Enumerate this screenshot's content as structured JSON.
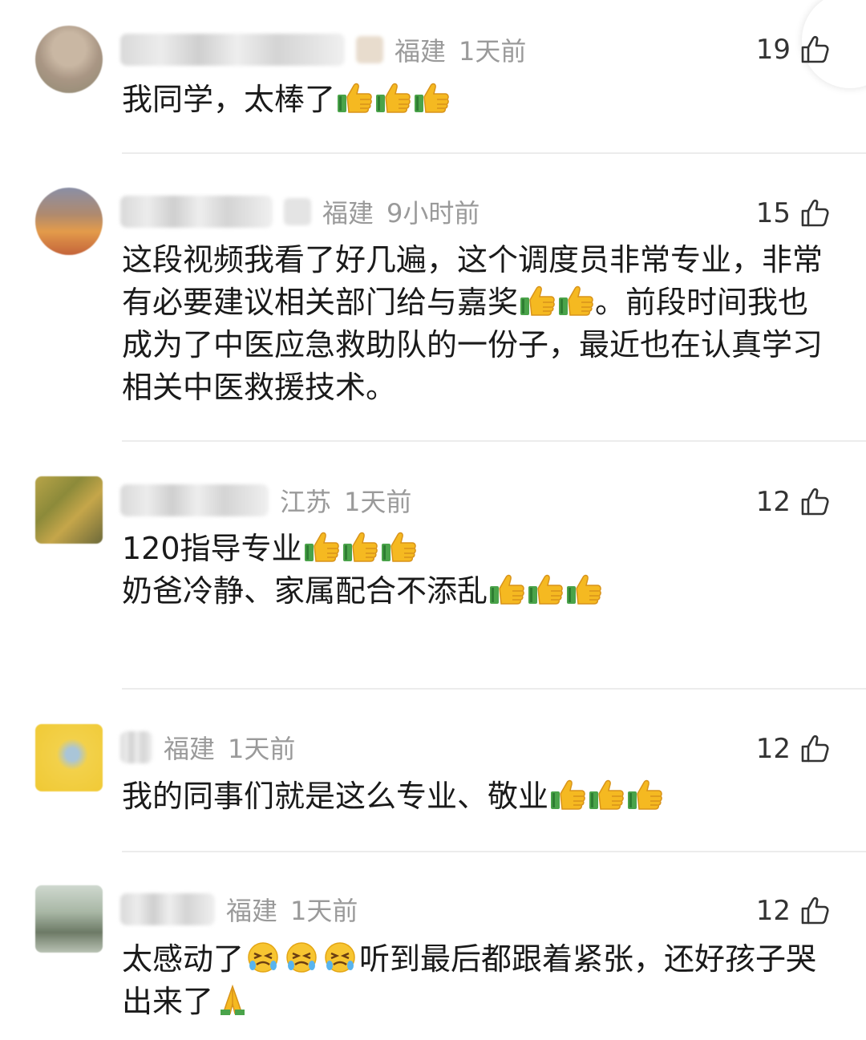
{
  "comments": [
    {
      "location": "福建",
      "time": "1天前",
      "likes": "19",
      "text_parts": [
        "我同学，太棒了"
      ],
      "emoji_counts": [
        3
      ]
    },
    {
      "location": "福建",
      "time": "9小时前",
      "likes": "15",
      "text_a": "这段视频我看了好几遍，这个调度员非常专业，非常有必要建议相关部门给与嘉奖",
      "text_b": "。前段时间我也成为了中医应急救助队的一份子，最近也在认真学习相关中医救援技术。"
    },
    {
      "location": "江苏",
      "time": "1天前",
      "likes": "12",
      "line1": "120指导专业",
      "line2": "奶爸冷静、家属配合不添乱"
    },
    {
      "location": "福建",
      "time": "1天前",
      "likes": "12",
      "text": "我的同事们就是这么专业、敬业"
    },
    {
      "location": "福建",
      "time": "1天前",
      "likes": "12",
      "text_a": "太感动了",
      "text_b": "听到最后都跟着紧张，还好孩子哭出来了"
    }
  ],
  "icons": {
    "like": "thumbs-up-outline-icon",
    "thumb_emoji": "thumbs-up-emoji",
    "cry_emoji": "crying-face-emoji",
    "pray_emoji": "folded-hands-emoji"
  },
  "colors": {
    "meta_gray": "#9a9a9a",
    "divider": "#ececec",
    "emoji_yellow": "#f5b921"
  }
}
